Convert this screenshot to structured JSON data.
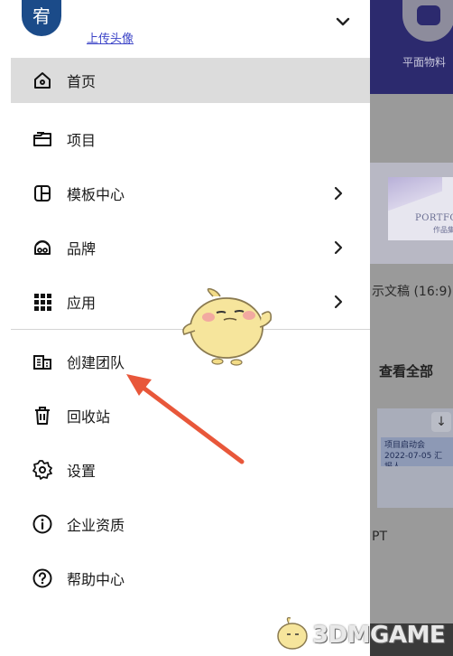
{
  "avatar": {
    "char": "宥"
  },
  "header": {
    "upload_avatar_label": "上传头像"
  },
  "menu": [
    {
      "label": "首页",
      "icon": "home-icon",
      "active": true,
      "has_chevron": false
    },
    {
      "label": "项目",
      "icon": "folder-icon",
      "active": false,
      "has_chevron": false
    },
    {
      "label": "模板中心",
      "icon": "template-icon",
      "active": false,
      "has_chevron": true
    },
    {
      "label": "品牌",
      "icon": "brand-icon",
      "active": false,
      "has_chevron": true
    },
    {
      "label": "应用",
      "icon": "apps-grid-icon",
      "active": false,
      "has_chevron": true
    }
  ],
  "menu_secondary": [
    {
      "label": "创建团队",
      "icon": "team-building-icon"
    },
    {
      "label": "回收站",
      "icon": "trash-icon"
    },
    {
      "label": "设置",
      "icon": "gear-icon"
    },
    {
      "label": "企业资质",
      "icon": "info-icon"
    },
    {
      "label": "帮助中心",
      "icon": "help-icon"
    }
  ],
  "background": {
    "header_label": "平面物料",
    "card_title": "PORTFOLIO",
    "card_subtitle": "作品集",
    "card_caption": "示文稿 (16:9)",
    "view_all": "查看全部",
    "thumb_text": "项目启动会 2022-07-05 汇报人",
    "bottom_caption": "PT"
  },
  "watermark": {
    "text": "3DMGAME"
  },
  "colors": {
    "accent_link": "#3c44c7",
    "active_item_bg": "#dcdcdc",
    "avatar_bg": "#1b4b89",
    "arrow": "#e8573a"
  }
}
